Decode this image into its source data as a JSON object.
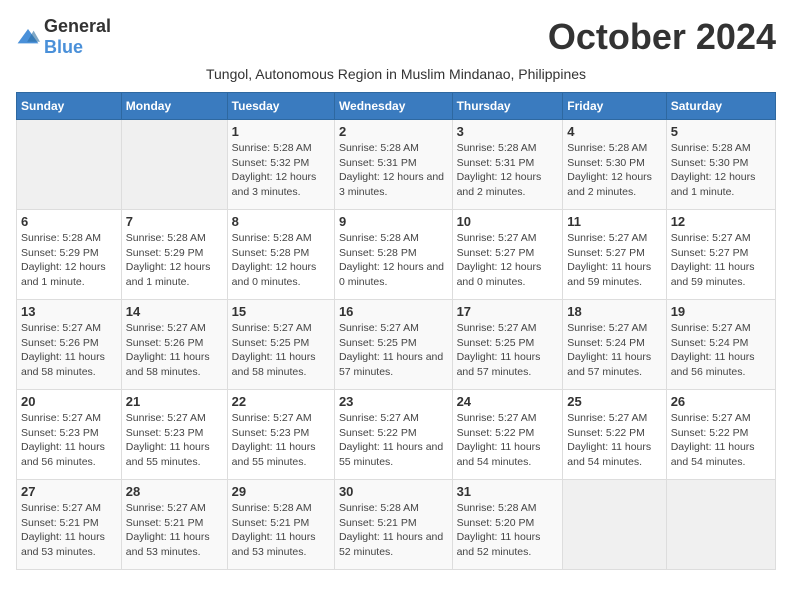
{
  "logo": {
    "general": "General",
    "blue": "Blue"
  },
  "title": "October 2024",
  "subtitle": "Tungol, Autonomous Region in Muslim Mindanao, Philippines",
  "days_header": [
    "Sunday",
    "Monday",
    "Tuesday",
    "Wednesday",
    "Thursday",
    "Friday",
    "Saturday"
  ],
  "weeks": [
    [
      {
        "day": "",
        "info": ""
      },
      {
        "day": "",
        "info": ""
      },
      {
        "day": "1",
        "info": "Sunrise: 5:28 AM\nSunset: 5:32 PM\nDaylight: 12 hours and 3 minutes."
      },
      {
        "day": "2",
        "info": "Sunrise: 5:28 AM\nSunset: 5:31 PM\nDaylight: 12 hours and 3 minutes."
      },
      {
        "day": "3",
        "info": "Sunrise: 5:28 AM\nSunset: 5:31 PM\nDaylight: 12 hours and 2 minutes."
      },
      {
        "day": "4",
        "info": "Sunrise: 5:28 AM\nSunset: 5:30 PM\nDaylight: 12 hours and 2 minutes."
      },
      {
        "day": "5",
        "info": "Sunrise: 5:28 AM\nSunset: 5:30 PM\nDaylight: 12 hours and 1 minute."
      }
    ],
    [
      {
        "day": "6",
        "info": "Sunrise: 5:28 AM\nSunset: 5:29 PM\nDaylight: 12 hours and 1 minute."
      },
      {
        "day": "7",
        "info": "Sunrise: 5:28 AM\nSunset: 5:29 PM\nDaylight: 12 hours and 1 minute."
      },
      {
        "day": "8",
        "info": "Sunrise: 5:28 AM\nSunset: 5:28 PM\nDaylight: 12 hours and 0 minutes."
      },
      {
        "day": "9",
        "info": "Sunrise: 5:28 AM\nSunset: 5:28 PM\nDaylight: 12 hours and 0 minutes."
      },
      {
        "day": "10",
        "info": "Sunrise: 5:27 AM\nSunset: 5:27 PM\nDaylight: 12 hours and 0 minutes."
      },
      {
        "day": "11",
        "info": "Sunrise: 5:27 AM\nSunset: 5:27 PM\nDaylight: 11 hours and 59 minutes."
      },
      {
        "day": "12",
        "info": "Sunrise: 5:27 AM\nSunset: 5:27 PM\nDaylight: 11 hours and 59 minutes."
      }
    ],
    [
      {
        "day": "13",
        "info": "Sunrise: 5:27 AM\nSunset: 5:26 PM\nDaylight: 11 hours and 58 minutes."
      },
      {
        "day": "14",
        "info": "Sunrise: 5:27 AM\nSunset: 5:26 PM\nDaylight: 11 hours and 58 minutes."
      },
      {
        "day": "15",
        "info": "Sunrise: 5:27 AM\nSunset: 5:25 PM\nDaylight: 11 hours and 58 minutes."
      },
      {
        "day": "16",
        "info": "Sunrise: 5:27 AM\nSunset: 5:25 PM\nDaylight: 11 hours and 57 minutes."
      },
      {
        "day": "17",
        "info": "Sunrise: 5:27 AM\nSunset: 5:25 PM\nDaylight: 11 hours and 57 minutes."
      },
      {
        "day": "18",
        "info": "Sunrise: 5:27 AM\nSunset: 5:24 PM\nDaylight: 11 hours and 57 minutes."
      },
      {
        "day": "19",
        "info": "Sunrise: 5:27 AM\nSunset: 5:24 PM\nDaylight: 11 hours and 56 minutes."
      }
    ],
    [
      {
        "day": "20",
        "info": "Sunrise: 5:27 AM\nSunset: 5:23 PM\nDaylight: 11 hours and 56 minutes."
      },
      {
        "day": "21",
        "info": "Sunrise: 5:27 AM\nSunset: 5:23 PM\nDaylight: 11 hours and 55 minutes."
      },
      {
        "day": "22",
        "info": "Sunrise: 5:27 AM\nSunset: 5:23 PM\nDaylight: 11 hours and 55 minutes."
      },
      {
        "day": "23",
        "info": "Sunrise: 5:27 AM\nSunset: 5:22 PM\nDaylight: 11 hours and 55 minutes."
      },
      {
        "day": "24",
        "info": "Sunrise: 5:27 AM\nSunset: 5:22 PM\nDaylight: 11 hours and 54 minutes."
      },
      {
        "day": "25",
        "info": "Sunrise: 5:27 AM\nSunset: 5:22 PM\nDaylight: 11 hours and 54 minutes."
      },
      {
        "day": "26",
        "info": "Sunrise: 5:27 AM\nSunset: 5:22 PM\nDaylight: 11 hours and 54 minutes."
      }
    ],
    [
      {
        "day": "27",
        "info": "Sunrise: 5:27 AM\nSunset: 5:21 PM\nDaylight: 11 hours and 53 minutes."
      },
      {
        "day": "28",
        "info": "Sunrise: 5:27 AM\nSunset: 5:21 PM\nDaylight: 11 hours and 53 minutes."
      },
      {
        "day": "29",
        "info": "Sunrise: 5:28 AM\nSunset: 5:21 PM\nDaylight: 11 hours and 53 minutes."
      },
      {
        "day": "30",
        "info": "Sunrise: 5:28 AM\nSunset: 5:21 PM\nDaylight: 11 hours and 52 minutes."
      },
      {
        "day": "31",
        "info": "Sunrise: 5:28 AM\nSunset: 5:20 PM\nDaylight: 11 hours and 52 minutes."
      },
      {
        "day": "",
        "info": ""
      },
      {
        "day": "",
        "info": ""
      }
    ]
  ]
}
